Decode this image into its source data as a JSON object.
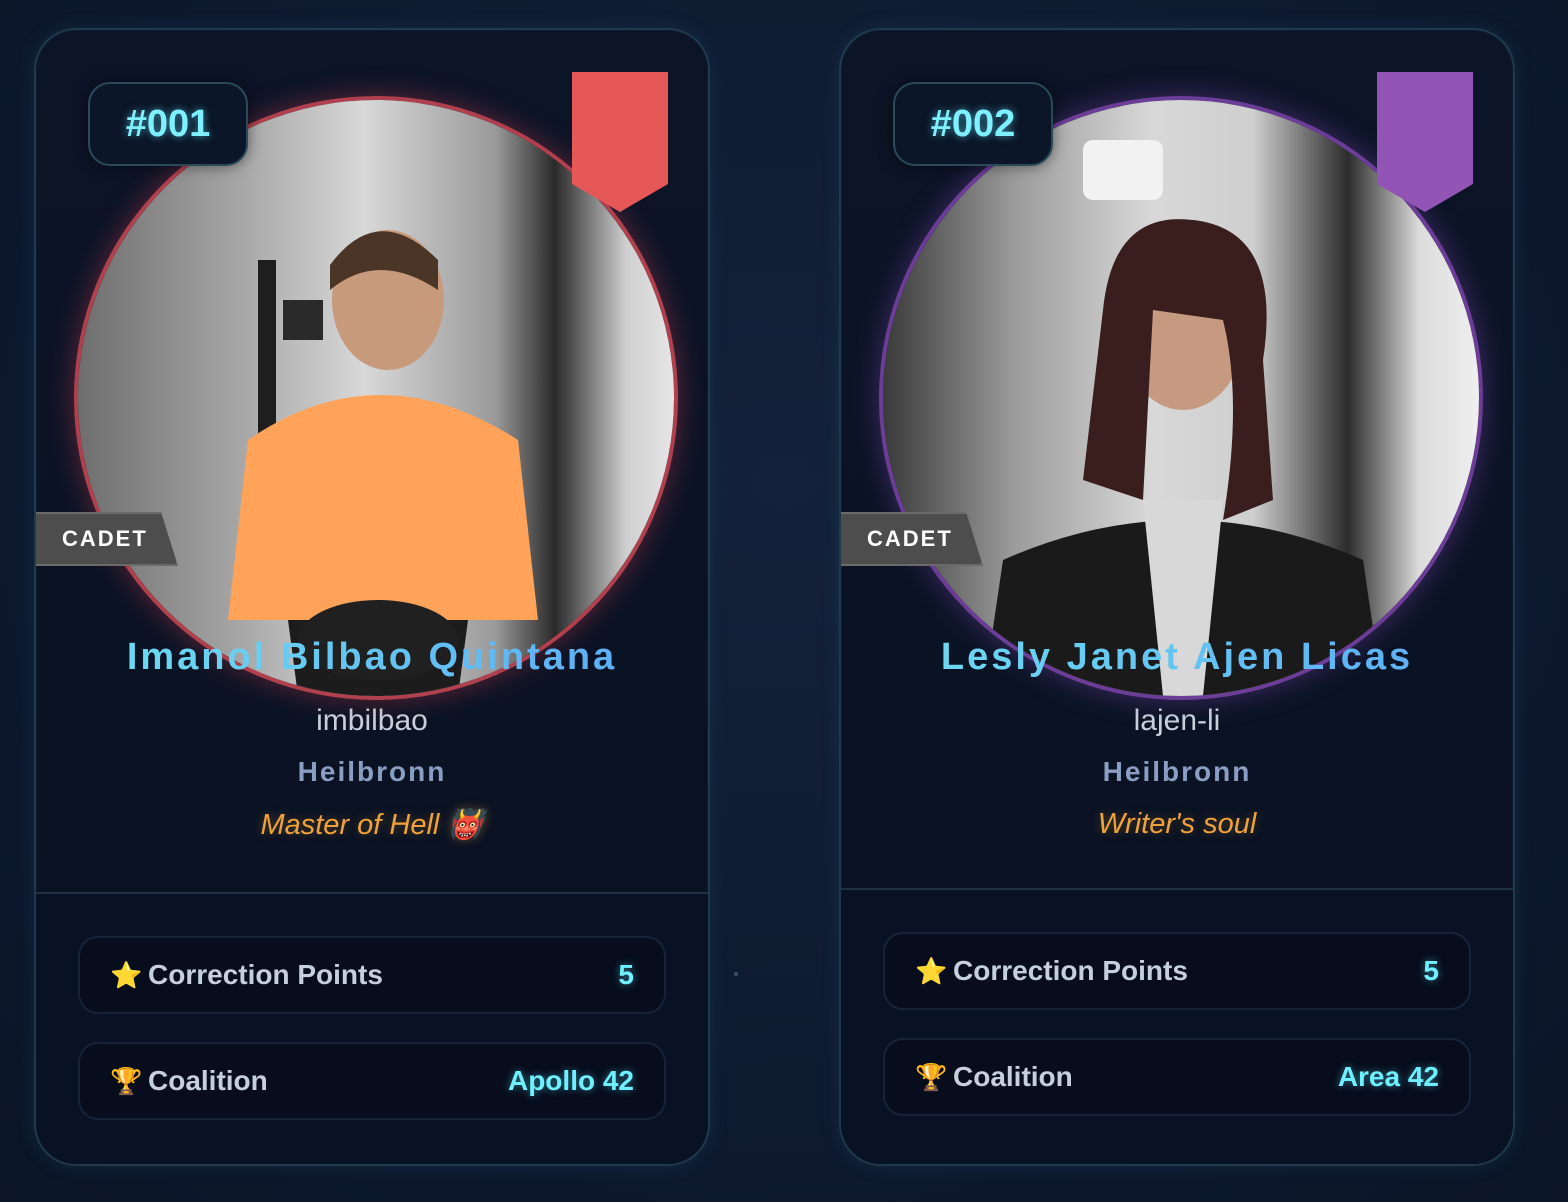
{
  "cards": [
    {
      "rank": "#001",
      "badge": "CADET",
      "name": "Imanol Bilbao Quintana",
      "login": "imbilbao",
      "campus": "Heilbronn",
      "title": "Master of Hell 👹",
      "ribbon_color": "#e65757",
      "ring_color": "#b0404e",
      "stats": [
        {
          "icon": "⭐",
          "label": "Correction Points",
          "value": "5"
        },
        {
          "icon": "🏆",
          "label": "Coalition",
          "value": "Apollo 42"
        }
      ]
    },
    {
      "rank": "#002",
      "badge": "CADET",
      "name": "Lesly Janet Ajen Licas",
      "login": "lajen-li",
      "campus": "Heilbronn",
      "title": "Writer's soul",
      "ribbon_color": "#9255b5",
      "ring_color": "#6c3d96",
      "stats": [
        {
          "icon": "⭐",
          "label": "Correction Points",
          "value": "5"
        },
        {
          "icon": "🏆",
          "label": "Coalition",
          "value": "Area 42"
        }
      ]
    }
  ]
}
